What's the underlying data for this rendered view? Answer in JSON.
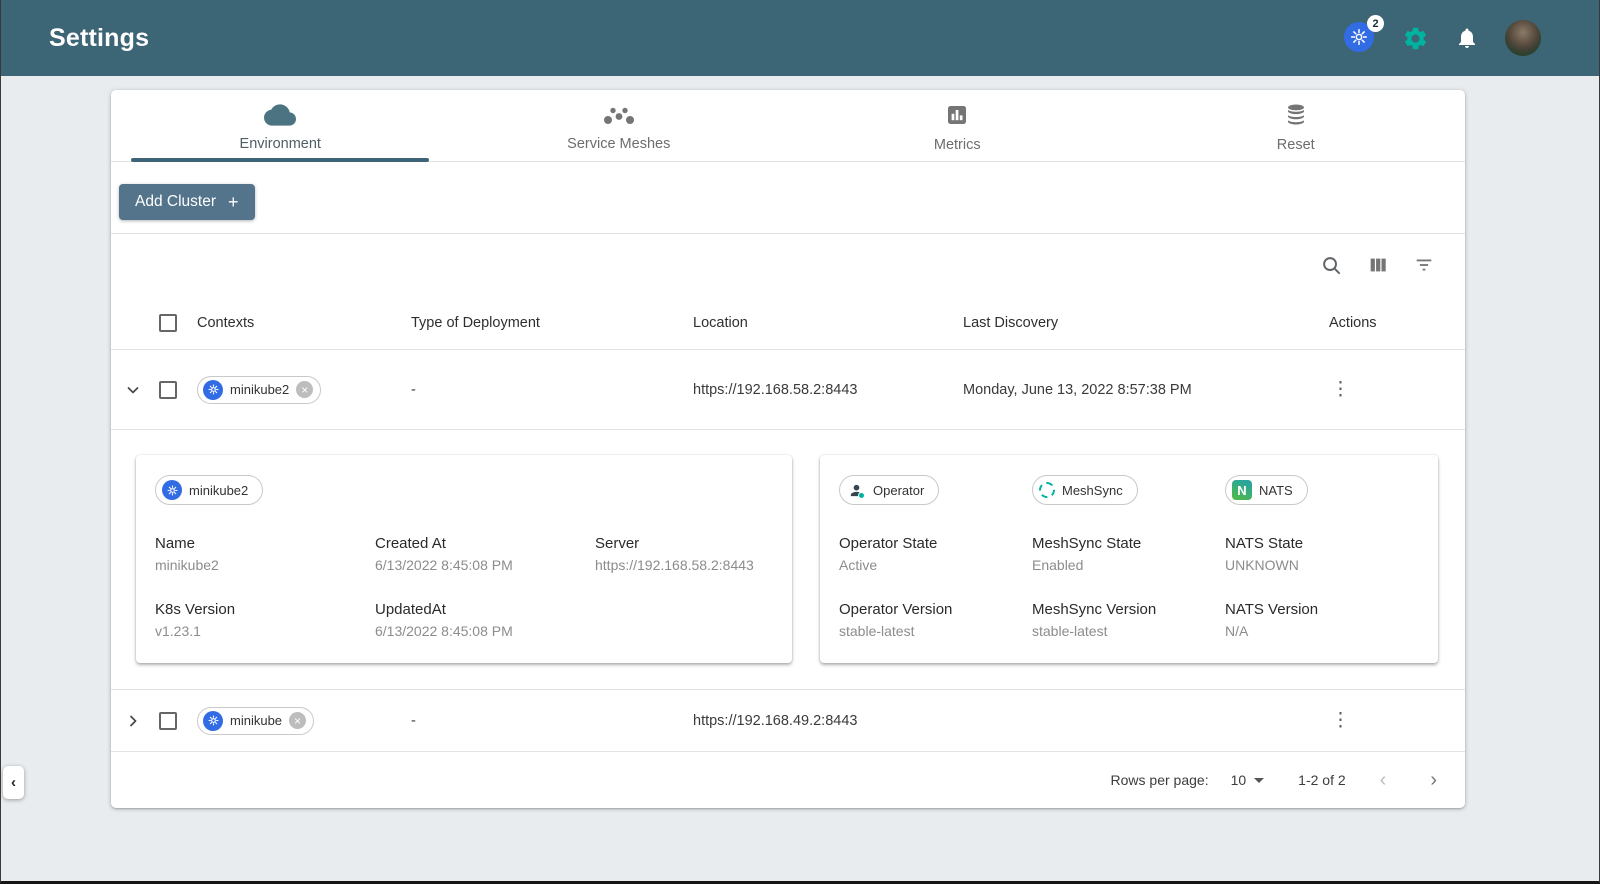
{
  "colors": {
    "header_bg": "#3c6575",
    "accent_green": "#00b39f",
    "k8s_blue": "#326ce5",
    "add_button_bg": "#54748c"
  },
  "header": {
    "title": "Settings",
    "k8s_context_count": "2"
  },
  "tabs": [
    {
      "label": "Environment",
      "active": true
    },
    {
      "label": "Service Meshes",
      "active": false
    },
    {
      "label": "Metrics",
      "active": false
    },
    {
      "label": "Reset",
      "active": false
    }
  ],
  "add_cluster": {
    "label": "Add Cluster",
    "plus": "+"
  },
  "table": {
    "columns": [
      "Contexts",
      "Type of Deployment",
      "Location",
      "Last Discovery",
      "Actions"
    ],
    "rows": [
      {
        "context": "minikube2",
        "type_of_deployment": "-",
        "location": "https://192.168.58.2:8443",
        "last_discovery": "Monday, June 13, 2022 8:57:38 PM"
      },
      {
        "context": "minikube",
        "type_of_deployment": "-",
        "location": "https://192.168.49.2:8443",
        "last_discovery": ""
      }
    ]
  },
  "expanded_detail": {
    "cluster_chip": "minikube2",
    "left_fields": [
      {
        "label": "Name",
        "value": "minikube2"
      },
      {
        "label": "Created At",
        "value": "6/13/2022 8:45:08 PM"
      },
      {
        "label": "Server",
        "value": "https://192.168.58.2:8443"
      },
      {
        "label": "K8s Version",
        "value": "v1.23.1"
      },
      {
        "label": "UpdatedAt",
        "value": "6/13/2022 8:45:08 PM"
      }
    ],
    "right_chips": [
      "Operator",
      "MeshSync",
      "NATS"
    ],
    "nats_logo_letter": "N",
    "right_fields": [
      {
        "label": "Operator State",
        "value": "Active"
      },
      {
        "label": "MeshSync State",
        "value": "Enabled"
      },
      {
        "label": "NATS State",
        "value": "UNKNOWN"
      },
      {
        "label": "Operator Version",
        "value": "stable-latest"
      },
      {
        "label": "MeshSync Version",
        "value": "stable-latest"
      },
      {
        "label": "NATS Version",
        "value": "N/A"
      }
    ]
  },
  "pagination": {
    "rows_per_page_label": "Rows per page:",
    "rows_per_page": "10",
    "range": "1-2 of 2"
  }
}
